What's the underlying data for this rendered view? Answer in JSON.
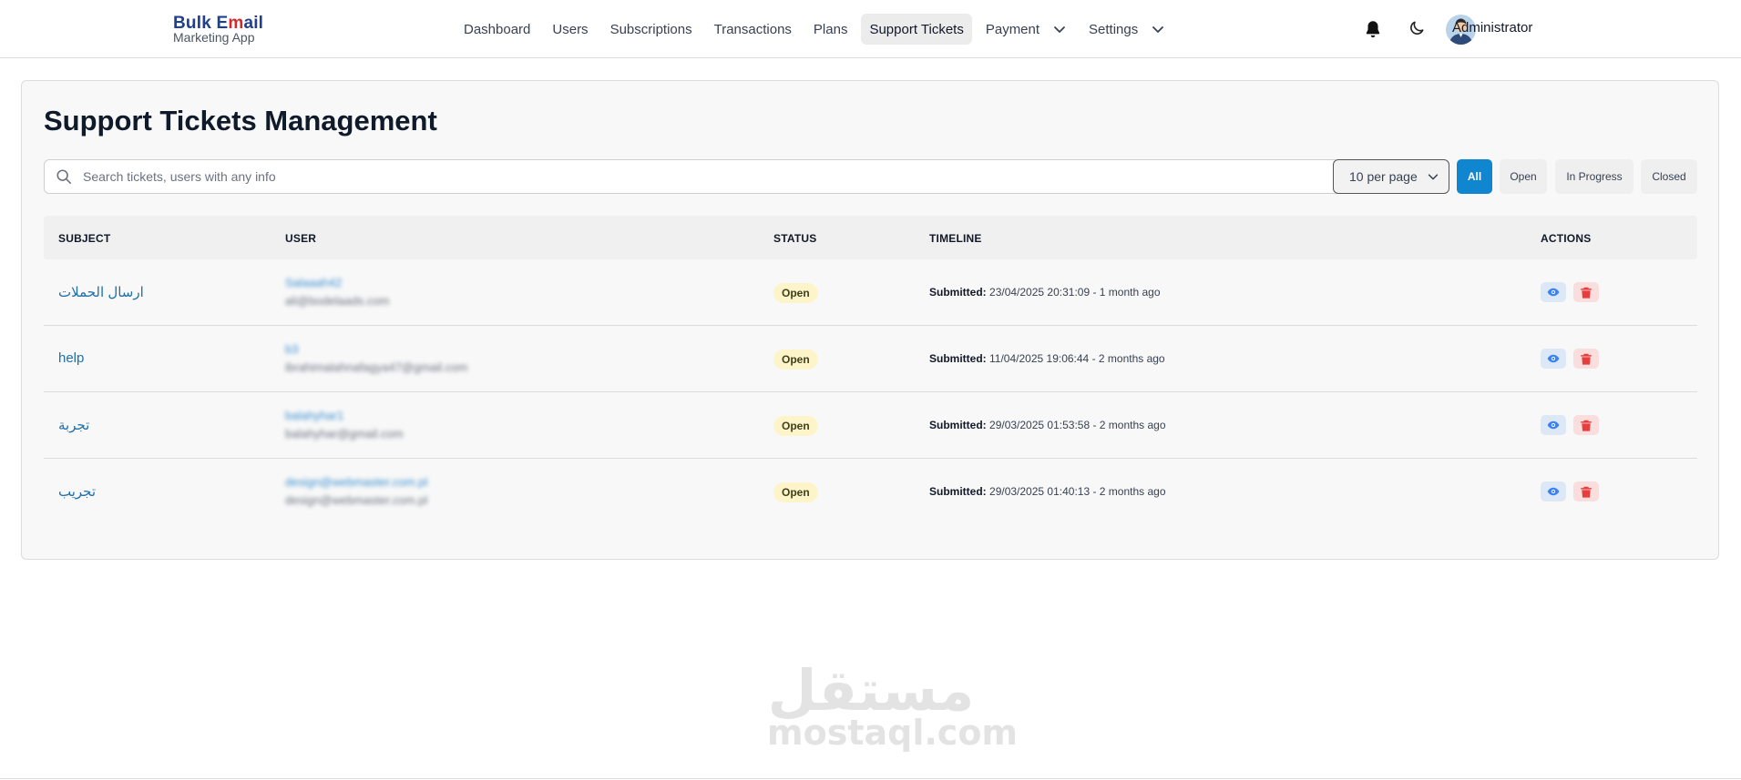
{
  "brand": {
    "line1_a": "Bulk E",
    "line1_b": "m",
    "line1_c": "ail",
    "line2": "Marketing App"
  },
  "nav": {
    "items": [
      {
        "label": "Dashboard"
      },
      {
        "label": "Users"
      },
      {
        "label": "Subscriptions"
      },
      {
        "label": "Transactions"
      },
      {
        "label": "Plans"
      },
      {
        "label": "Support Tickets",
        "active": true
      },
      {
        "label": "Payment",
        "dropdown": true
      },
      {
        "label": "Settings",
        "dropdown": true
      }
    ]
  },
  "header": {
    "user_name": "Administrator",
    "icons": [
      "bell-icon",
      "moon-icon",
      "avatar"
    ]
  },
  "page": {
    "title": "Support Tickets Management"
  },
  "search": {
    "placeholder": "Search tickets, users with any info"
  },
  "per_page": {
    "selected": "10 per page"
  },
  "filters": {
    "all": "All",
    "open": "Open",
    "in_progress": "In Progress",
    "closed": "Closed",
    "active": "All"
  },
  "table": {
    "headers": {
      "subject": "SUBJECT",
      "user": "USER",
      "status": "STATUS",
      "timeline": "TIMELINE",
      "actions": "ACTIONS"
    },
    "rows": [
      {
        "subject": "ارسال الحملات",
        "user_name": "Salaaah42",
        "user_email": "ali@bodelaads.com",
        "status": "Open",
        "submitted_label": "Submitted:",
        "submitted": "23/04/2025 20:31:09 - 1 month ago"
      },
      {
        "subject": "help",
        "user_name": "b3",
        "user_email": "ibrahimalahnafagya47@gmail.com",
        "status": "Open",
        "submitted_label": "Submitted:",
        "submitted": "11/04/2025 19:06:44 - 2 months ago"
      },
      {
        "subject": "تجربة",
        "user_name": "balahyhar1",
        "user_email": "balahyhar@gmail.com",
        "status": "Open",
        "submitted_label": "Submitted:",
        "submitted": "29/03/2025 01:53:58 - 2 months ago"
      },
      {
        "subject": "تجريب",
        "user_name": "design@webmaster.com.pl",
        "user_email": "design@webmaster.com.pl",
        "status": "Open",
        "submitted_label": "Submitted:",
        "submitted": "29/03/2025 01:40:13 - 2 months ago"
      }
    ]
  },
  "watermark": {
    "arabic": "مستقل",
    "latin": "mostaql.com"
  },
  "colors": {
    "accent": "#0f86cf",
    "badge_open": "#fdf5c9",
    "link": "#1e6fa8",
    "view": "#3b82f6",
    "delete": "#e53e3e"
  }
}
